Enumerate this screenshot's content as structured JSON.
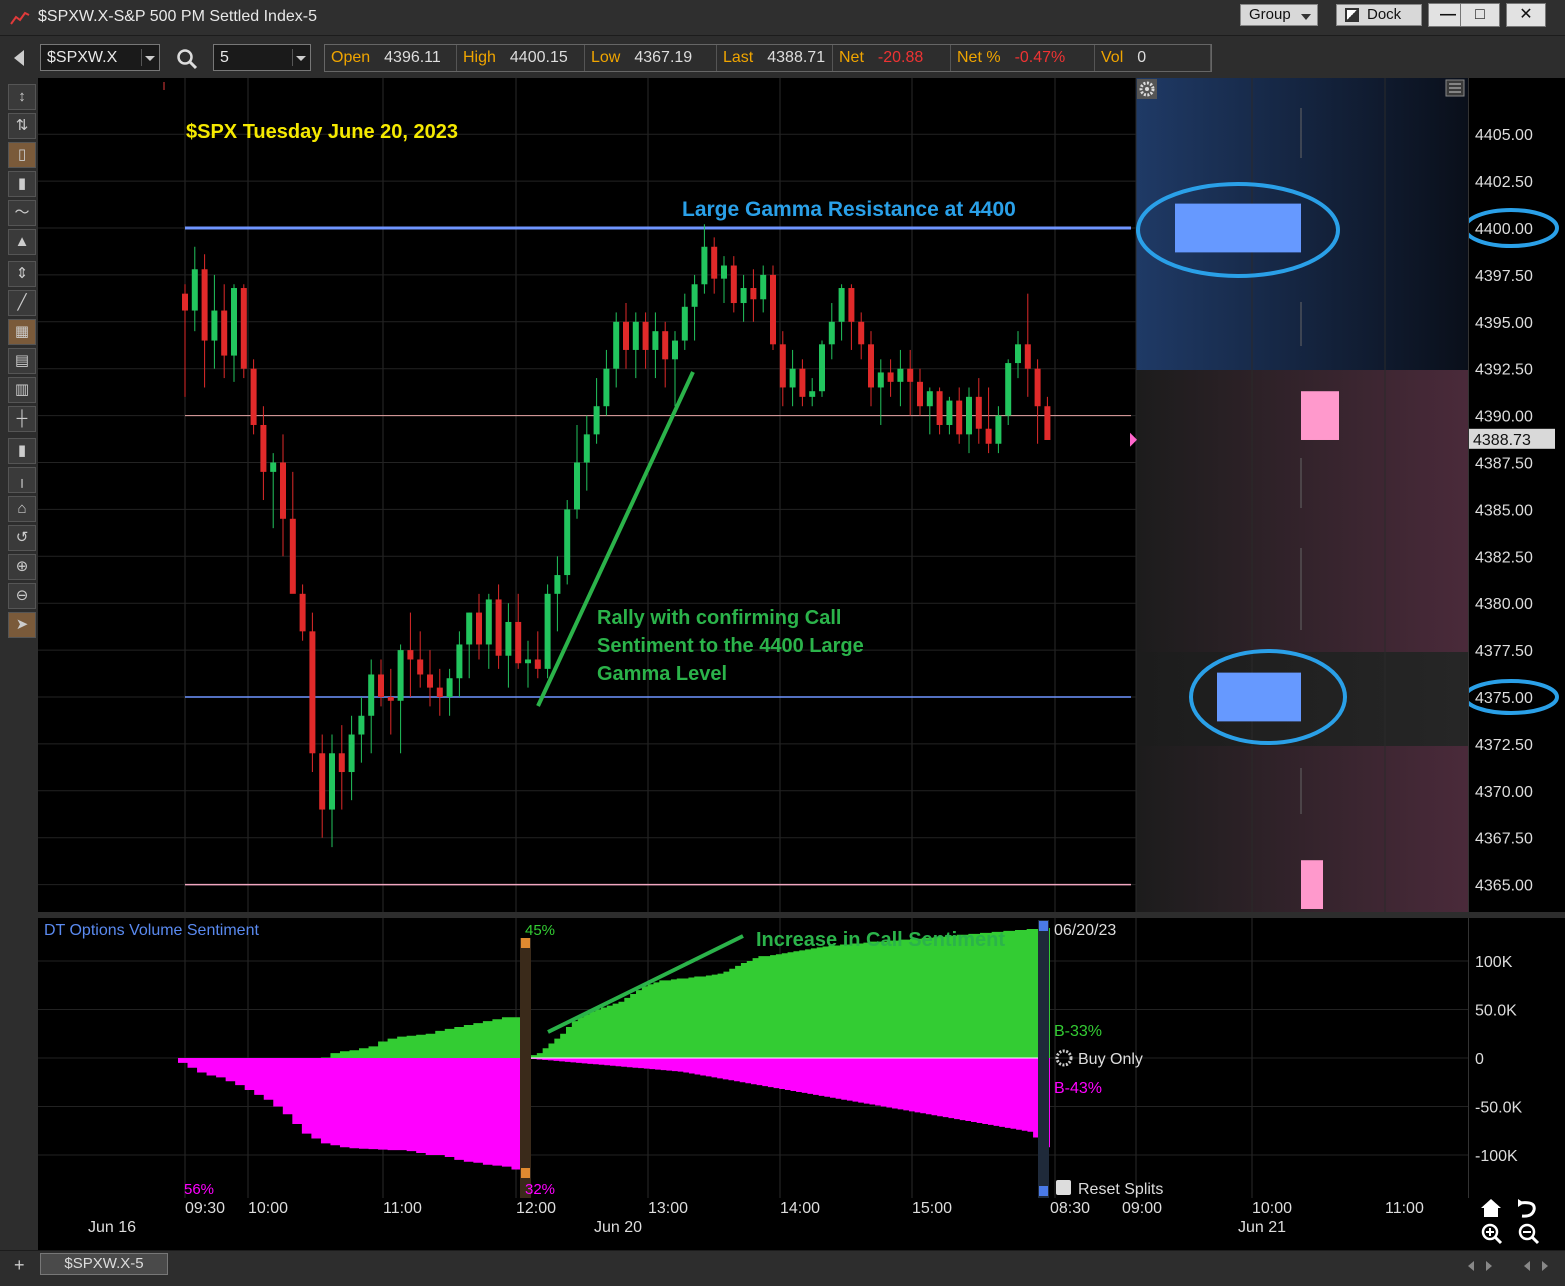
{
  "window": {
    "title": "$SPXW.X-S&P 500 PM Settled Index-5",
    "group_label": "Group",
    "dock_label": "Dock",
    "minimize": "—",
    "maximize": "□",
    "close": "✕"
  },
  "toolbar": {
    "symbol": "$SPXW.X",
    "interval": "5",
    "quote": [
      {
        "label": "Open",
        "value": "4396.11",
        "neg": false
      },
      {
        "label": "High",
        "value": "4400.15",
        "neg": false
      },
      {
        "label": "Low",
        "value": "4367.19",
        "neg": false
      },
      {
        "label": "Last",
        "value": "4388.71",
        "neg": false
      },
      {
        "label": "Net",
        "value": "-20.88",
        "neg": true
      },
      {
        "label": "Net %",
        "value": "-0.47%",
        "neg": true
      },
      {
        "label": "Vol",
        "value": "0",
        "neg": false
      }
    ]
  },
  "left_tools": [
    "↕",
    "⇅",
    "▯",
    "▮",
    "〜",
    "▲",
    "⇕",
    "╱",
    "▦",
    "▤",
    "▥",
    "┼",
    "▮",
    "╷",
    "⌂",
    "↺",
    "⊕",
    "⊖",
    "➤"
  ],
  "annotations": {
    "title": "$SPX Tuesday June 20, 2023",
    "gamma_resistance": "Large Gamma Resistance at 4400",
    "rally_line1": "Rally with confirming Call",
    "rally_line2": "Sentiment to the 4400 Large",
    "rally_line3": "Gamma Level",
    "call_increase": "Increase in Call Sentiment"
  },
  "price_axis": {
    "ticks": [
      "4405.00",
      "4402.50",
      "4400.00",
      "4397.50",
      "4395.00",
      "4392.50",
      "4390.00",
      "4387.50",
      "4385.00",
      "4382.50",
      "4380.00",
      "4377.50",
      "4375.00",
      "4372.50",
      "4370.00",
      "4367.50",
      "4365.00"
    ],
    "last_price_label": "4388.73"
  },
  "indicator": {
    "title": "DT Options Volume Sentiment",
    "split_top_pct": "45%",
    "split_bottom_pct": "32%",
    "left_bottom_pct": "56%",
    "date_label": "06/20/23",
    "call_label": "B-33%",
    "put_label": "B-43%",
    "buy_only": "Buy Only",
    "reset_splits": "Reset Splits",
    "axis_ticks": [
      "100K",
      "50.0K",
      "0",
      "-50.0K",
      "-100K"
    ]
  },
  "time_axis": {
    "day_labels": [
      "Jun 16",
      "Jun 20",
      "Jun 21"
    ],
    "time_labels": [
      "09:30",
      "10:00",
      "11:00",
      "12:00",
      "13:00",
      "14:00",
      "15:00",
      "08:30",
      "09:00",
      "10:00",
      "11:00"
    ]
  },
  "bottom": {
    "tab_label": "$SPXW.X-5",
    "add": "+"
  },
  "colors": {
    "up": "#22c55e",
    "down": "#e02a2a",
    "gamma_line": "#6f95ff",
    "call_area": "#33cc33",
    "put_area": "#ff00ff",
    "annotation_green": "#2bb34a",
    "annotation_blue": "#2aa0e8",
    "annotation_yellow": "#f5e900",
    "qlabel": "#f0a500"
  },
  "chart_data": {
    "type": "candlestick",
    "title": "$SPX Tuesday June 20, 2023",
    "ylim": [
      4363.5,
      4408.5
    ],
    "reference_lines": [
      4400,
      4375,
      4390,
      4365
    ],
    "candles": [
      [
        4396.5,
        4397.0,
        4391.0,
        4395.6
      ],
      [
        4395.6,
        4399.0,
        4394.5,
        4397.8
      ],
      [
        4397.8,
        4398.6,
        4391.5,
        4394.0
      ],
      [
        4394.0,
        4397.5,
        4392.5,
        4395.6
      ],
      [
        4395.6,
        4397.0,
        4392.0,
        4393.2
      ],
      [
        4393.2,
        4397.0,
        4391.8,
        4396.8
      ],
      [
        4396.8,
        4397.0,
        4392.0,
        4392.5
      ],
      [
        4392.5,
        4393.0,
        4389.0,
        4389.5
      ],
      [
        4389.5,
        4390.5,
        4385.5,
        4387.0
      ],
      [
        4387.0,
        4388.0,
        4384.0,
        4387.5
      ],
      [
        4387.5,
        4389.0,
        4382.5,
        4384.5
      ],
      [
        4384.5,
        4387.0,
        4381.5,
        4380.5
      ],
      [
        4380.5,
        4381.0,
        4378.0,
        4378.5
      ],
      [
        4378.5,
        4379.5,
        4371.0,
        4372.0
      ],
      [
        4372.0,
        4373.0,
        4367.5,
        4369.0
      ],
      [
        4369.0,
        4373.0,
        4367.0,
        4372.0
      ],
      [
        4372.0,
        4373.5,
        4369.0,
        4371.0
      ],
      [
        4371.0,
        4374.0,
        4369.5,
        4373.0
      ],
      [
        4373.0,
        4375.0,
        4371.5,
        4374.0
      ],
      [
        4374.0,
        4377.0,
        4372.0,
        4376.2
      ],
      [
        4376.2,
        4377.0,
        4374.5,
        4375.0
      ],
      [
        4375.0,
        4376.5,
        4373.0,
        4374.8
      ],
      [
        4374.8,
        4377.8,
        4372.0,
        4377.5
      ],
      [
        4377.5,
        4379.5,
        4375.0,
        4377.0
      ],
      [
        4377.0,
        4378.5,
        4375.5,
        4376.2
      ],
      [
        4376.2,
        4377.5,
        4374.5,
        4375.5
      ],
      [
        4375.5,
        4376.5,
        4374.0,
        4375.0
      ],
      [
        4375.0,
        4376.5,
        4374.0,
        4376.0
      ],
      [
        4376.0,
        4378.5,
        4375.0,
        4377.8
      ],
      [
        4377.8,
        4379.5,
        4376.0,
        4379.5
      ],
      [
        4379.5,
        4380.5,
        4377.0,
        4377.8
      ],
      [
        4377.8,
        4380.5,
        4376.5,
        4380.2
      ],
      [
        4380.2,
        4381.0,
        4376.5,
        4377.2
      ],
      [
        4377.2,
        4380.0,
        4375.5,
        4379.0
      ],
      [
        4379.0,
        4380.5,
        4376.5,
        4376.8
      ],
      [
        4376.8,
        4378.0,
        4375.5,
        4377.0
      ],
      [
        4377.0,
        4378.5,
        4376.0,
        4376.5
      ],
      [
        4376.5,
        4381.0,
        4376.0,
        4380.5
      ],
      [
        4380.5,
        4382.5,
        4378.5,
        4381.5
      ],
      [
        4381.5,
        4385.5,
        4381.0,
        4385.0
      ],
      [
        4385.0,
        4389.5,
        4384.5,
        4387.5
      ],
      [
        4387.5,
        4390.0,
        4386.0,
        4389.0
      ],
      [
        4389.0,
        4392.0,
        4388.5,
        4390.5
      ],
      [
        4390.5,
        4393.5,
        4390.0,
        4392.5
      ],
      [
        4392.5,
        4395.5,
        4391.5,
        4395.0
      ],
      [
        4395.0,
        4396.0,
        4392.5,
        4393.5
      ],
      [
        4393.5,
        4395.5,
        4392.0,
        4395.0
      ],
      [
        4395.0,
        4395.5,
        4392.5,
        4393.5
      ],
      [
        4393.5,
        4395.5,
        4392.0,
        4394.5
      ],
      [
        4394.5,
        4395.0,
        4391.5,
        4393.0
      ],
      [
        4393.0,
        4394.5,
        4390.5,
        4394.0
      ],
      [
        4394.0,
        4396.5,
        4393.5,
        4395.8
      ],
      [
        4395.8,
        4397.5,
        4394.0,
        4397.0
      ],
      [
        4397.0,
        4400.2,
        4396.5,
        4399.0
      ],
      [
        4399.0,
        4399.5,
        4396.5,
        4397.3
      ],
      [
        4397.3,
        4398.5,
        4396.0,
        4398.0
      ],
      [
        4398.0,
        4398.5,
        4395.5,
        4396.0
      ],
      [
        4396.0,
        4397.5,
        4395.0,
        4396.8
      ],
      [
        4396.8,
        4397.8,
        4395.0,
        4396.2
      ],
      [
        4396.2,
        4398.0,
        4395.5,
        4397.5
      ],
      [
        4397.5,
        4398.0,
        4393.5,
        4393.8
      ],
      [
        4393.8,
        4394.5,
        4390.5,
        4391.5
      ],
      [
        4391.5,
        4393.5,
        4390.5,
        4392.5
      ],
      [
        4392.5,
        4393.0,
        4390.5,
        4391.0
      ],
      [
        4391.0,
        4392.0,
        4390.5,
        4391.3
      ],
      [
        4391.3,
        4394.0,
        4391.0,
        4393.8
      ],
      [
        4393.8,
        4396.0,
        4393.0,
        4395.0
      ],
      [
        4395.0,
        4397.0,
        4394.0,
        4396.8
      ],
      [
        4396.8,
        4397.0,
        4393.5,
        4395.0
      ],
      [
        4395.0,
        4395.5,
        4393.0,
        4393.8
      ],
      [
        4393.8,
        4394.5,
        4390.5,
        4391.5
      ],
      [
        4391.5,
        4393.0,
        4389.5,
        4392.3
      ],
      [
        4392.3,
        4393.0,
        4391.0,
        4391.8
      ],
      [
        4391.8,
        4393.5,
        4390.5,
        4392.5
      ],
      [
        4392.5,
        4393.5,
        4390.0,
        4391.8
      ],
      [
        4391.8,
        4392.5,
        4390.0,
        4390.5
      ],
      [
        4390.5,
        4391.5,
        4389.0,
        4391.3
      ],
      [
        4391.3,
        4391.5,
        4389.0,
        4389.5
      ],
      [
        4389.5,
        4391.0,
        4389.0,
        4390.8
      ],
      [
        4390.8,
        4391.5,
        4388.5,
        4389.0
      ],
      [
        4389.0,
        4391.5,
        4388.0,
        4391.0
      ],
      [
        4391.0,
        4392.0,
        4388.5,
        4389.3
      ],
      [
        4389.3,
        4391.5,
        4388.0,
        4388.5
      ],
      [
        4388.5,
        4390.5,
        4388.0,
        4390.0
      ],
      [
        4390.0,
        4393.0,
        4389.5,
        4392.8
      ],
      [
        4392.8,
        4394.5,
        4392.0,
        4393.8
      ],
      [
        4393.8,
        4396.5,
        4391.0,
        4392.5
      ],
      [
        4392.5,
        4393.0,
        4388.5,
        4390.5
      ],
      [
        4390.5,
        4391.0,
        4388.8,
        4388.7
      ]
    ],
    "gamma_levels": [
      {
        "price": 4400,
        "side": "call",
        "relative_size": 1.0
      },
      {
        "price": 4375,
        "side": "call",
        "relative_size": 0.85
      },
      {
        "price": 4390,
        "side": "put",
        "relative_size": 0.4
      },
      {
        "price": 4365,
        "side": "put",
        "relative_size": 0.25
      }
    ],
    "sentiment": {
      "ylim": [
        -130000,
        130000
      ],
      "segment1": {
        "calls": [
          0,
          0,
          0,
          0,
          0,
          0,
          0,
          0,
          0,
          0,
          0,
          0,
          0,
          0,
          0,
          500,
          5000,
          7000,
          8000,
          10000,
          12000,
          17000,
          20000,
          22000,
          23000,
          24000,
          25000,
          28000,
          30000,
          32000,
          34000,
          36000,
          38000,
          40000,
          42000,
          42000
        ],
        "puts": [
          -5000,
          -10000,
          -15000,
          -18000,
          -20000,
          -24000,
          -28000,
          -33000,
          -38000,
          -43000,
          -50000,
          -58000,
          -68000,
          -78000,
          -83000,
          -88000,
          -90000,
          -92000,
          -93000,
          -93500,
          -94000,
          -94500,
          -95000,
          -95000,
          -96000,
          -98000,
          -100000,
          -100000,
          -102000,
          -105000,
          -107000,
          -108000,
          -110000,
          -111000,
          -112000,
          -115000
        ]
      },
      "segment2": {
        "calls": [
          3000,
          5000,
          10000,
          15000,
          20000,
          25000,
          32000,
          38000,
          42000,
          45000,
          48000,
          50000,
          52000,
          54000,
          56000,
          58000,
          62000,
          66000,
          70000,
          74000,
          76000,
          78000,
          80000,
          80000,
          81000,
          82000,
          82000,
          83000,
          84000,
          84000,
          85000,
          86000,
          87000,
          89000,
          92000,
          95000,
          98000,
          100000,
          103000,
          105000,
          105000,
          106000,
          107000,
          108000,
          109000,
          110000,
          111000,
          112000,
          113000,
          114000,
          115000,
          116000,
          116000,
          117000,
          117000,
          118000,
          118000,
          119000,
          120000,
          120000,
          120000,
          121000,
          121000,
          122000,
          122000,
          123000,
          123000,
          124000,
          124000,
          125000,
          125000,
          126000,
          126000,
          127000,
          127000,
          128000,
          128000,
          129000,
          129000,
          130000,
          130000,
          131000,
          131000,
          132000,
          132000,
          133000,
          133000,
          134000,
          134000
        ],
        "puts": [
          -1000,
          -1500,
          -2000,
          -2500,
          -3000,
          -3500,
          -4000,
          -4500,
          -5000,
          -5500,
          -6000,
          -6500,
          -7000,
          -7500,
          -8000,
          -8500,
          -9000,
          -9500,
          -10000,
          -10500,
          -11000,
          -11500,
          -12000,
          -12500,
          -13000,
          -13500,
          -14000,
          -15000,
          -16000,
          -17000,
          -18000,
          -19000,
          -20000,
          -21000,
          -22000,
          -23000,
          -24000,
          -25000,
          -26000,
          -27000,
          -28000,
          -29000,
          -30000,
          -31000,
          -32000,
          -33000,
          -34000,
          -35000,
          -36000,
          -37000,
          -38000,
          -39000,
          -40000,
          -41000,
          -42000,
          -43000,
          -44000,
          -45000,
          -46000,
          -47000,
          -48000,
          -49000,
          -50000,
          -51000,
          -52000,
          -53000,
          -54000,
          -55000,
          -56000,
          -57000,
          -58000,
          -59000,
          -60000,
          -61000,
          -62000,
          -63000,
          -64000,
          -65000,
          -66000,
          -67000,
          -68000,
          -69000,
          -70000,
          -71000,
          -72000,
          -73000,
          -74000,
          -75000,
          -76000,
          -82000,
          -88000,
          -92000
        ]
      }
    }
  }
}
